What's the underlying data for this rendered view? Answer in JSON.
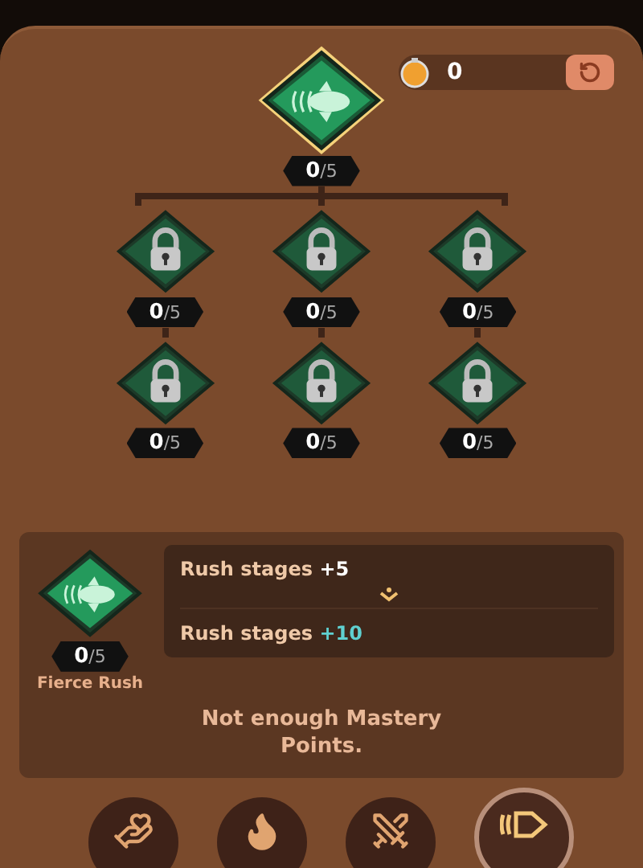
{
  "points": {
    "value": "0"
  },
  "top_node": {
    "value": "0",
    "max": "/5",
    "selected": true,
    "locked": false
  },
  "rows": [
    {
      "nodes": [
        {
          "value": "0",
          "max": "/5",
          "selected": false,
          "locked": true
        },
        {
          "value": "0",
          "max": "/5",
          "selected": false,
          "locked": true
        },
        {
          "value": "0",
          "max": "/5",
          "selected": false,
          "locked": true
        }
      ]
    },
    {
      "nodes": [
        {
          "value": "0",
          "max": "/5",
          "selected": false,
          "locked": true
        },
        {
          "value": "0",
          "max": "/5",
          "selected": false,
          "locked": true
        },
        {
          "value": "0",
          "max": "/5",
          "selected": false,
          "locked": true
        }
      ]
    }
  ],
  "detail": {
    "name": "Fierce Rush",
    "value": "0",
    "max": "/5",
    "effects": [
      {
        "kind": "current",
        "label": "Rush stages",
        "amount": "+5"
      },
      {
        "kind": "next",
        "label": "Rush stages",
        "amount": "+10"
      }
    ],
    "message": "Not enough Mastery Points."
  },
  "tabs": [
    {
      "kind": "hands",
      "selected": false
    },
    {
      "kind": "flame",
      "selected": false
    },
    {
      "kind": "swords",
      "selected": false
    },
    {
      "kind": "rush",
      "selected": true
    }
  ]
}
